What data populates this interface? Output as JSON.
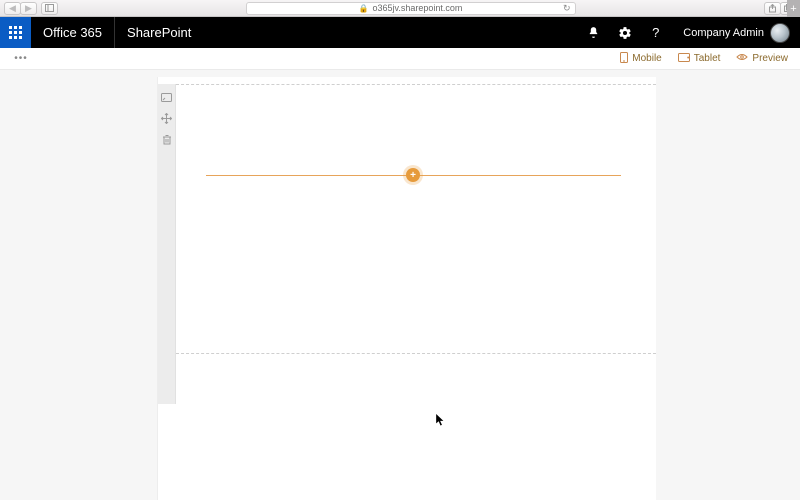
{
  "browser": {
    "url": "o365jv.sharepoint.com"
  },
  "suite": {
    "brand": "Office 365",
    "app": "SharePoint",
    "user": "Company Admin"
  },
  "commands": {
    "mobile": "Mobile",
    "tablet": "Tablet",
    "preview": "Preview"
  }
}
